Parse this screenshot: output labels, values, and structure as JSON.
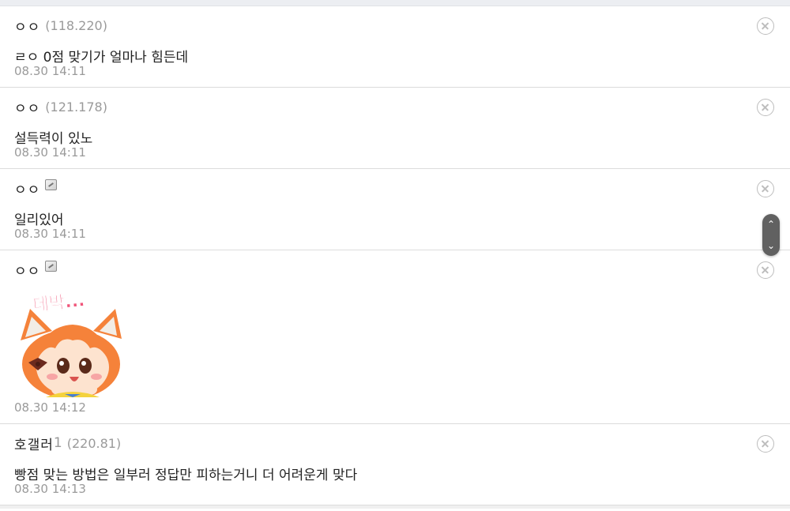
{
  "comments": [
    {
      "nick": "ㅇㅇ",
      "ip": "(118.220)",
      "text": "ㄹㅇ 0점 맞기가 얼마나 힘든데",
      "time": "08.30 14:11"
    },
    {
      "nick": "ㅇㅇ",
      "ip": "(121.178)",
      "text": "설득력이 있노",
      "time": "08.30 14:11"
    },
    {
      "nick": "ㅇㅇ",
      "badge_icon": "fixed-nick-badge-icon",
      "text": "일리있어",
      "time": "08.30 14:11"
    },
    {
      "nick": "ㅇㅇ",
      "badge_icon": "fixed-nick-badge-icon",
      "sticker_text": "데박...",
      "time": "08.30 14:12"
    },
    {
      "nick": "호갤러",
      "nick_sub": "1",
      "ip": "(220.81)",
      "text": "빵점 맞는 방법은 일부러 정답만 피하는거니 더 어려운게 맞다",
      "time": "08.30 14:13"
    }
  ],
  "scroll": {
    "up_icon": "⌃",
    "down_icon": "⌄"
  },
  "colors": {
    "text": "#222222",
    "meta": "#9a9a9a",
    "divider": "#dcdcdc",
    "sticker_pink": "#f0557a",
    "sticker_hair": "#f5823a"
  }
}
